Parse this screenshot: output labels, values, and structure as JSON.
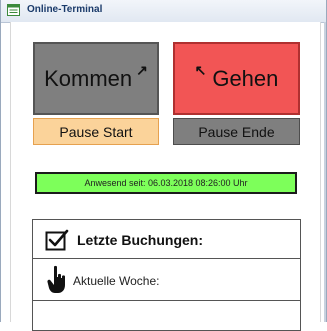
{
  "window": {
    "title": "Online-Terminal"
  },
  "buttons": {
    "kommen": "Kommen",
    "gehen": "Gehen",
    "pause_start": "Pause Start",
    "pause_ende": "Pause Ende"
  },
  "status": {
    "text": "Anwesend seit: 06.03.2018 08:26:00 Uhr"
  },
  "panels": {
    "letzte_buchungen": "Letzte Buchungen:",
    "aktuelle_woche": "Aktuelle Woche:"
  },
  "colors": {
    "kommen": "#7f7f7f",
    "gehen": "#f25555",
    "pause_start": "#fbd39a",
    "pause_ende": "#7f7f7f",
    "status": "#7dff5a"
  },
  "icons": {
    "title": "terminal-window-icon",
    "kommen": "arrow-up-right-icon",
    "gehen": "arrow-up-left-icon",
    "letzte_buchungen": "checkbox-checked-icon",
    "aktuelle_woche": "pointing-hand-icon"
  }
}
